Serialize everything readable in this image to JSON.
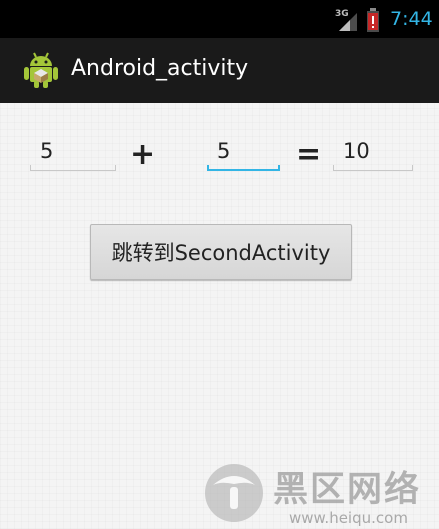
{
  "status_bar": {
    "network_type": "3G",
    "time": "7:44",
    "signal_icon": "signal-bars-icon",
    "battery_icon": "battery-low-icon",
    "accent_color": "#33b5e5"
  },
  "action_bar": {
    "app_icon": "android-robot-icon",
    "title": "Android_activity"
  },
  "calculator": {
    "first_operand": "5",
    "plus_sign": "+",
    "second_operand": "5",
    "equals_sign": "=",
    "result": "10"
  },
  "jump_button": {
    "label": "跳转到SecondActivity"
  },
  "watermark": {
    "chinese_text": "黑区网络",
    "url": "www.heiqu.com"
  }
}
